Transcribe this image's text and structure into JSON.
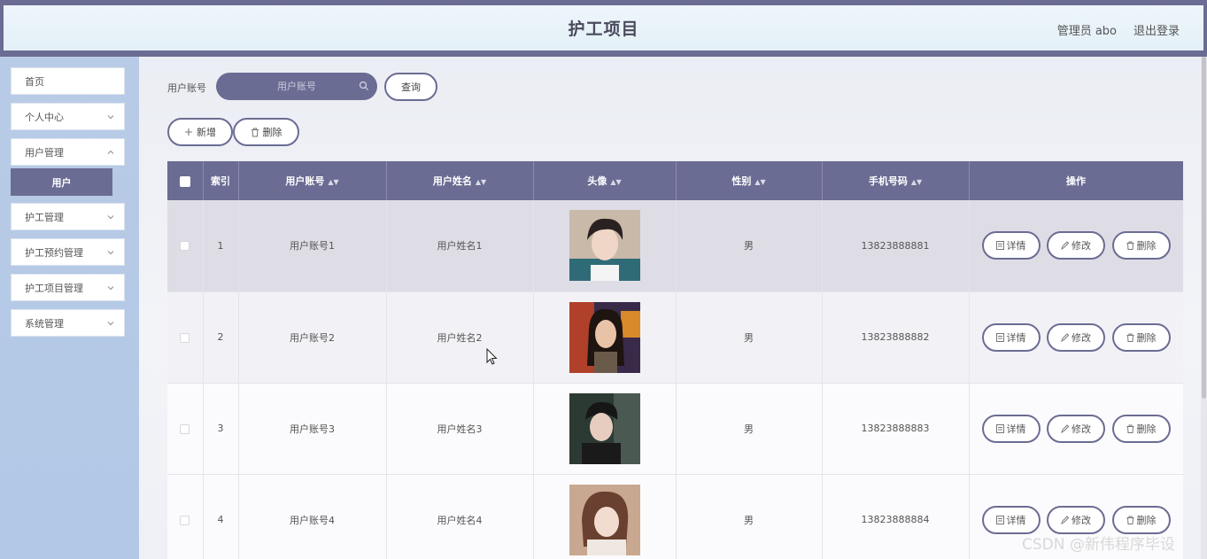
{
  "header": {
    "title": "护工项目",
    "user": "管理员 abo",
    "logout": "退出登录"
  },
  "sidebar": {
    "items": [
      {
        "label": "首页",
        "has_arrow": false
      },
      {
        "label": "个人中心",
        "has_arrow": true
      },
      {
        "label": "用户管理",
        "has_arrow": true
      },
      {
        "label": "护工管理",
        "has_arrow": true
      },
      {
        "label": "护工预约管理",
        "has_arrow": true
      },
      {
        "label": "护工项目管理",
        "has_arrow": true
      },
      {
        "label": "系统管理",
        "has_arrow": true
      }
    ],
    "active_sub": "用户"
  },
  "search": {
    "label": "用户账号",
    "placeholder": "用户账号",
    "query_button": "查询"
  },
  "toolbar": {
    "add_label": "新增",
    "delete_label": "删除"
  },
  "table": {
    "columns": [
      "索引",
      "用户账号",
      "用户姓名",
      "头像",
      "性别",
      "手机号码",
      "操作"
    ],
    "rows": [
      {
        "index": "1",
        "account": "用户账号1",
        "name": "用户姓名1",
        "avatar": "avatar-photo-1",
        "gender": "男",
        "phone": "13823888881"
      },
      {
        "index": "2",
        "account": "用户账号2",
        "name": "用户姓名2",
        "avatar": "avatar-photo-2",
        "gender": "男",
        "phone": "13823888882"
      },
      {
        "index": "3",
        "account": "用户账号3",
        "name": "用户姓名3",
        "avatar": "avatar-photo-3",
        "gender": "男",
        "phone": "13823888883"
      },
      {
        "index": "4",
        "account": "用户账号4",
        "name": "用户姓名4",
        "avatar": "avatar-photo-4",
        "gender": "男",
        "phone": "13823888884"
      }
    ],
    "actions": {
      "detail": "详情",
      "edit": "修改",
      "delete": "删除"
    }
  },
  "watermark": "CSDN @新伟程序毕设",
  "colors": {
    "accent": "#6b6c93",
    "sidebar_bg": "#b8cbe6",
    "header_bg": "#e3f0f7"
  }
}
